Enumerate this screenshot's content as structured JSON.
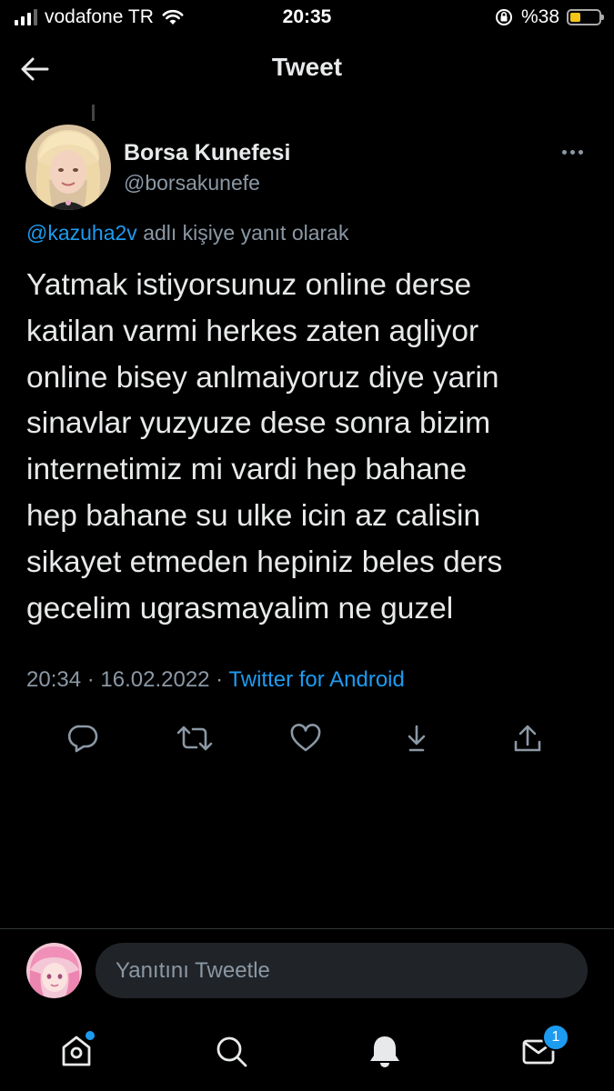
{
  "status_bar": {
    "carrier": "vodafone TR",
    "time": "20:35",
    "battery": "%38",
    "battery_level": 0.38
  },
  "header": {
    "title": "Tweet",
    "back_icon": "back-arrow-icon"
  },
  "tweet": {
    "author_name": "Borsa Kunefesi",
    "author_handle": "@borsakunefe",
    "reply_mention": "@kazuha2v",
    "reply_suffix": " adlı kişiye yanıt olarak",
    "text_lines": [
      "Yatmak istiyorsunuz online derse",
      "katilan varmi herkes zaten agliyor",
      "online bisey anlmaiyoruz diye yarin",
      "sinavlar yuzyuze dese sonra bizim",
      "internetimiz mi vardi hep bahane",
      "hep bahane su ulke icin az calisin",
      "sikayet etmeden hepiniz beles ders",
      "gecelim ugrasmayalim ne guzel"
    ],
    "time": "20:34",
    "separator": " · ",
    "date": "16.02.2022",
    "source": "Twitter for Android",
    "actions": [
      "reply-icon",
      "retweet-icon",
      "like-icon",
      "download-icon",
      "share-icon"
    ]
  },
  "reply_bar": {
    "placeholder": "Yanıtını Tweetle"
  },
  "bottom_nav": {
    "items": [
      "home-icon",
      "search-icon",
      "notifications-icon",
      "messages-icon"
    ],
    "messages_badge": "1"
  },
  "colors": {
    "background": "#000000",
    "text": "#e7e9ea",
    "secondary": "#8b98a5",
    "accent": "#1d9bf0"
  }
}
